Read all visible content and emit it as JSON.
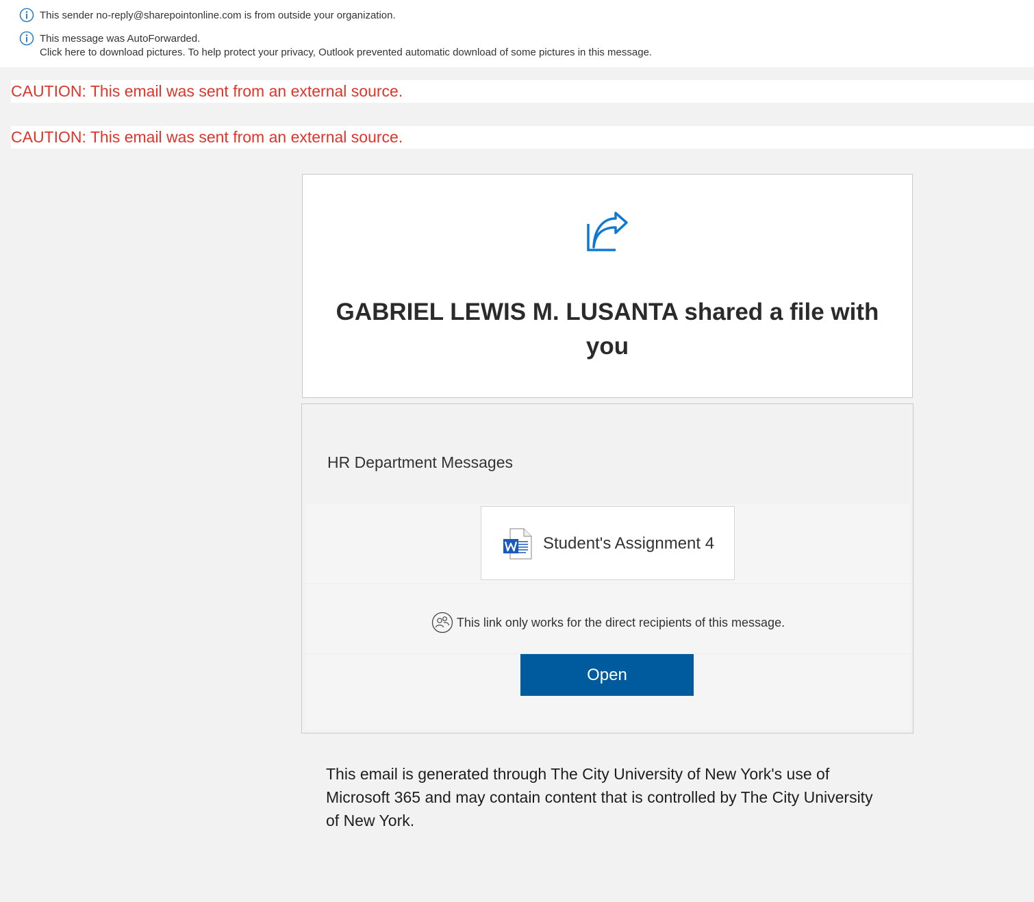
{
  "info_bar": {
    "sender_notice": "This sender no-reply@sharepointonline.com is from outside your organization.",
    "forward_notice": "This message was AutoForwarded.",
    "pictures_notice": "Click here to download pictures. To help protect your privacy, Outlook prevented automatic download of some pictures in this message."
  },
  "cautions": [
    "CAUTION: This email was sent from an external source.",
    "CAUTION: This email was sent from an external source."
  ],
  "share_card": {
    "icon": "share-arrow-icon",
    "headline": "GABRIEL LEWIS M. LUSANTA shared a file with you"
  },
  "file_card": {
    "site_name": "HR Department Messages",
    "file_icon": "word-document-icon",
    "file_name": "Student's Assignment 4",
    "recipients_notice": "This link only works for the direct recipients of this message.",
    "open_label": "Open"
  },
  "footer": {
    "text": "This email is generated through The City University of New York's use of Microsoft 365 and may contain content that is controlled by The City University of New York."
  },
  "colors": {
    "caution_red": "#e0342a",
    "button_blue": "#005a9e",
    "info_blue": "#2f7fc1",
    "background_gray": "#f2f2f2"
  }
}
